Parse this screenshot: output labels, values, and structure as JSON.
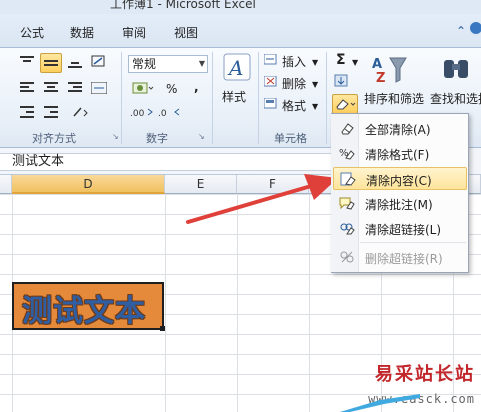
{
  "window": {
    "title": "工作薄1 - Microsoft Excel"
  },
  "tabs": [
    "公式",
    "数据",
    "审阅",
    "视图"
  ],
  "ribbon": {
    "font_size_combo": "常规",
    "percent_symbol": "%",
    "comma_symbol": ",",
    "style_label": "样式",
    "cells_insert": "插入",
    "cells_delete": "删除",
    "cells_format": "格式",
    "sum_symbol": "Σ",
    "sort_filter": "排序和筛选",
    "find_select": "查找和选择",
    "groups": {
      "alignment": "对齐方式",
      "number": "数字",
      "cells": "单元格"
    }
  },
  "formula_bar": {
    "value": "测试文本"
  },
  "columns": [
    "D",
    "E",
    "F"
  ],
  "cell": {
    "text": "测试文本",
    "fill_color": "#e58a3a",
    "text_color": "#2f5ea3"
  },
  "clear_menu": {
    "items": [
      {
        "label": "全部清除(A)",
        "icon": "eraser-icon",
        "highlighted": false,
        "enabled": true
      },
      {
        "label": "清除格式(F)",
        "icon": "clear-format-icon",
        "highlighted": false,
        "enabled": true
      },
      {
        "label": "清除内容(C)",
        "icon": "clear-contents-icon",
        "highlighted": true,
        "enabled": true
      },
      {
        "label": "清除批注(M)",
        "icon": "clear-comments-icon",
        "highlighted": false,
        "enabled": true
      },
      {
        "label": "清除超链接(L)",
        "icon": "clear-hyperlinks-icon",
        "highlighted": false,
        "enabled": true
      },
      {
        "label": "删除超链接(R)",
        "icon": "remove-hyperlinks-icon",
        "highlighted": false,
        "enabled": false
      }
    ]
  },
  "annotation": {
    "arrow_color": "#e0403a"
  },
  "watermark": {
    "line1": "易采站长站",
    "line2": "www.easck.com"
  }
}
